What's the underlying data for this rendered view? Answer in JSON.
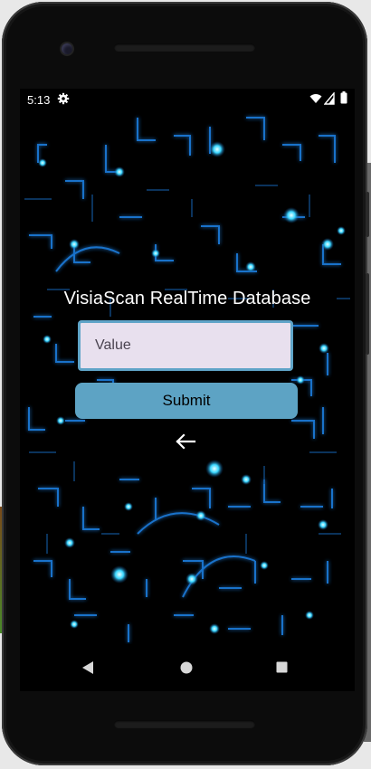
{
  "status_bar": {
    "time": "5:13",
    "icons": [
      "gear-icon",
      "wifi-icon",
      "signal-icon",
      "battery-icon"
    ]
  },
  "app": {
    "title": "VisiaScan RealTime Database",
    "value_field": {
      "placeholder": "Value",
      "value": ""
    },
    "submit_label": "Submit",
    "back_icon": "back-arrow-icon"
  },
  "nav_bar": {
    "icons": [
      "nav-back-icon",
      "nav-home-icon",
      "nav-recents-icon"
    ]
  },
  "colors": {
    "screen_background": "#000000",
    "input_fill": "#e8e0ee",
    "input_border": "#5fa4c8",
    "button_fill": "#5da3c4",
    "glow_accent": "#2fd0ff"
  }
}
